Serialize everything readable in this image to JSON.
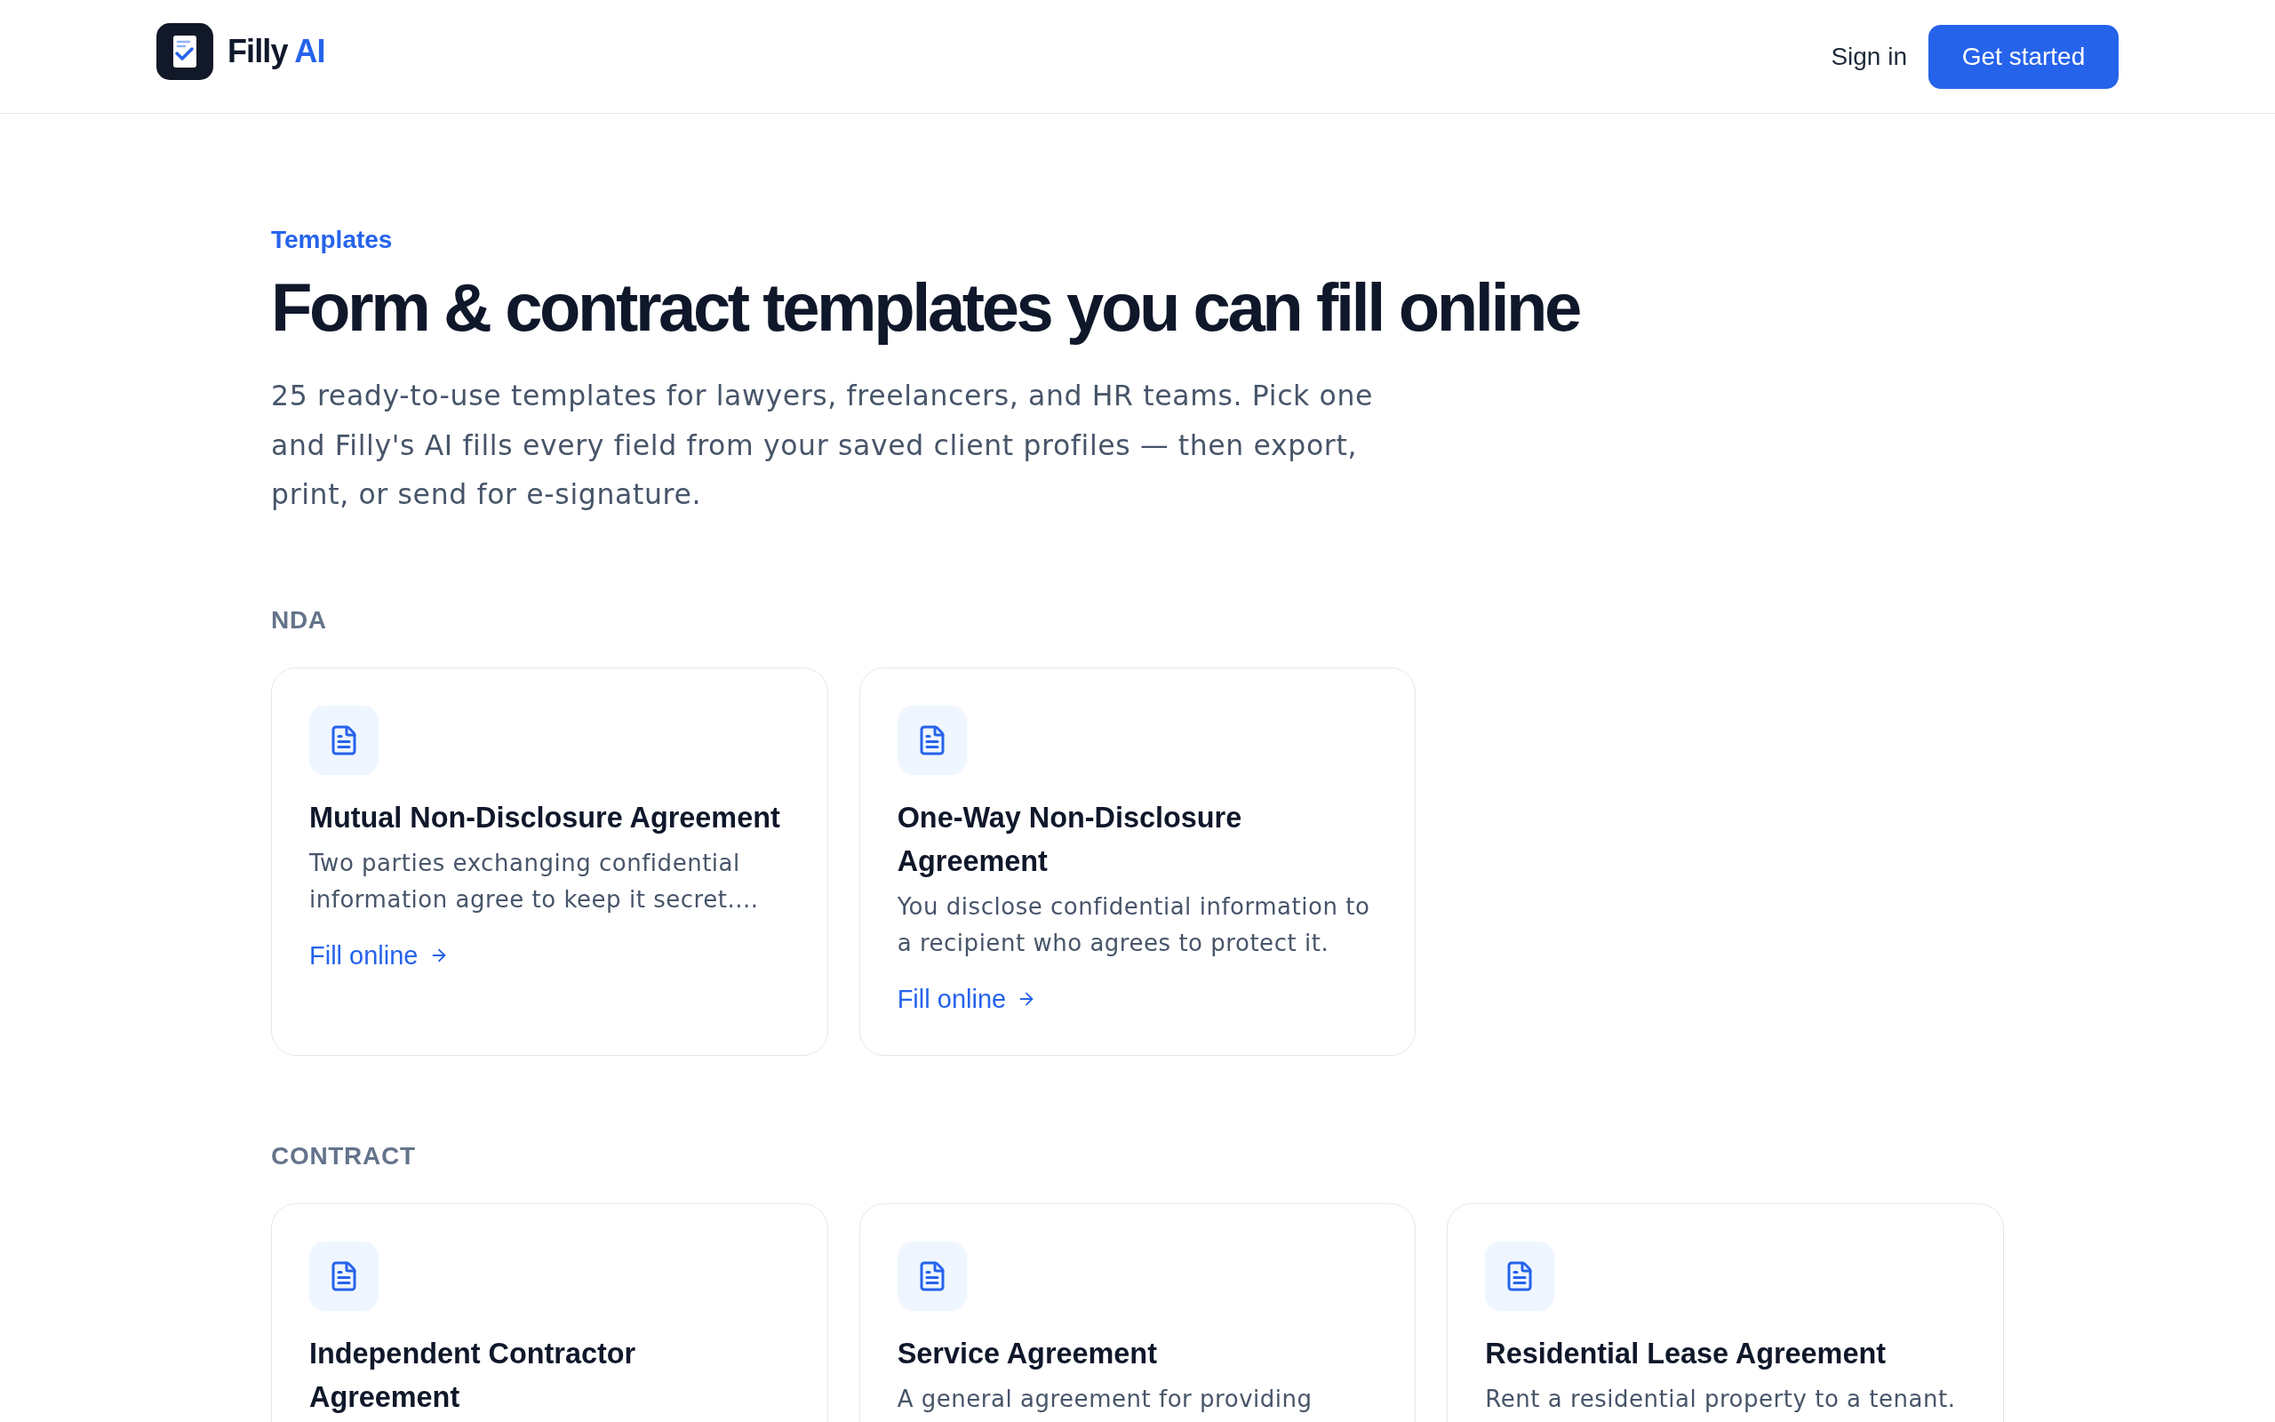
{
  "brand": {
    "name": "Filly",
    "accent": "AI"
  },
  "nav": {
    "sign_in": "Sign in",
    "cta": "Get started"
  },
  "hero": {
    "eyebrow": "Templates",
    "title": "Form & contract templates you can fill online",
    "description": "25 ready-to-use templates for lawyers, freelancers, and HR teams. Pick one and Filly's AI fills every field from your saved client profiles — then export, print, or send for e-signature."
  },
  "sections": [
    {
      "label": "NDA",
      "templates": [
        {
          "title": "Mutual Non-Disclosure Agreement",
          "description": "Two parties exchanging confidential information agree to keep it secret....",
          "link": "Fill online"
        },
        {
          "title": "One-Way Non-Disclosure Agreement",
          "description": "You disclose confidential information to a recipient who agrees to protect it.",
          "link": "Fill online"
        }
      ]
    },
    {
      "label": "CONTRACT",
      "templates": [
        {
          "title": "Independent Contractor Agreement"
        },
        {
          "title": "Service Agreement",
          "description": "A general agreement for providing"
        },
        {
          "title": "Residential Lease Agreement",
          "description": "Rent a residential property to a tenant."
        }
      ]
    }
  ]
}
